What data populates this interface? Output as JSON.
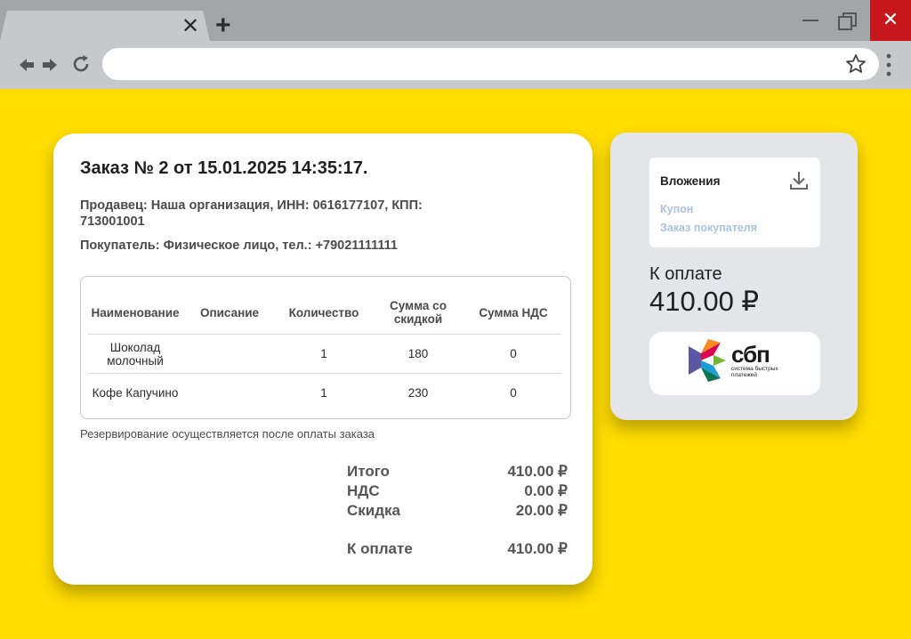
{
  "browser": {
    "tab_close": "✕",
    "new_tab": "+",
    "window_close": "✕",
    "address_value": ""
  },
  "receipt": {
    "title": "Заказ № 2 от 15.01.2025 14:35:17.",
    "seller": "Продавец: Наша организация, ИНН: 0616177107, КПП: 713001001",
    "buyer": "Покупатель: Физическое лицо, тел.: +79021111111",
    "table": {
      "headers": [
        "Наименование",
        "Описание",
        "Количество",
        "Сумма со скидкой",
        "Сумма НДС"
      ],
      "rows": [
        [
          "Шоколад молочный",
          "",
          "1",
          "180",
          "0"
        ],
        [
          "Кофе Капучино",
          "",
          "1",
          "230",
          "0"
        ]
      ]
    },
    "note": "Резервирование осуществляется после оплаты заказа",
    "totals": {
      "total_label": "Итого",
      "total_value": "410.00 ₽",
      "vat_label": "НДС",
      "vat_value": "0.00 ₽",
      "discount_label": "Скидка",
      "discount_value": "20.00 ₽",
      "pay_label": "К оплате",
      "pay_value": "410.00 ₽"
    }
  },
  "side": {
    "attachments_title": "Вложения",
    "attachments": [
      "Купон",
      "Заказ покупателя"
    ],
    "pay_label": "К оплате",
    "pay_amount": "410.00 ₽",
    "sbp_word": "сбп",
    "sbp_caption": "система быстрых платежей"
  },
  "colors": {
    "background": "#ffdd00",
    "link": "#a9c3df",
    "close_button": "#c8161d"
  }
}
